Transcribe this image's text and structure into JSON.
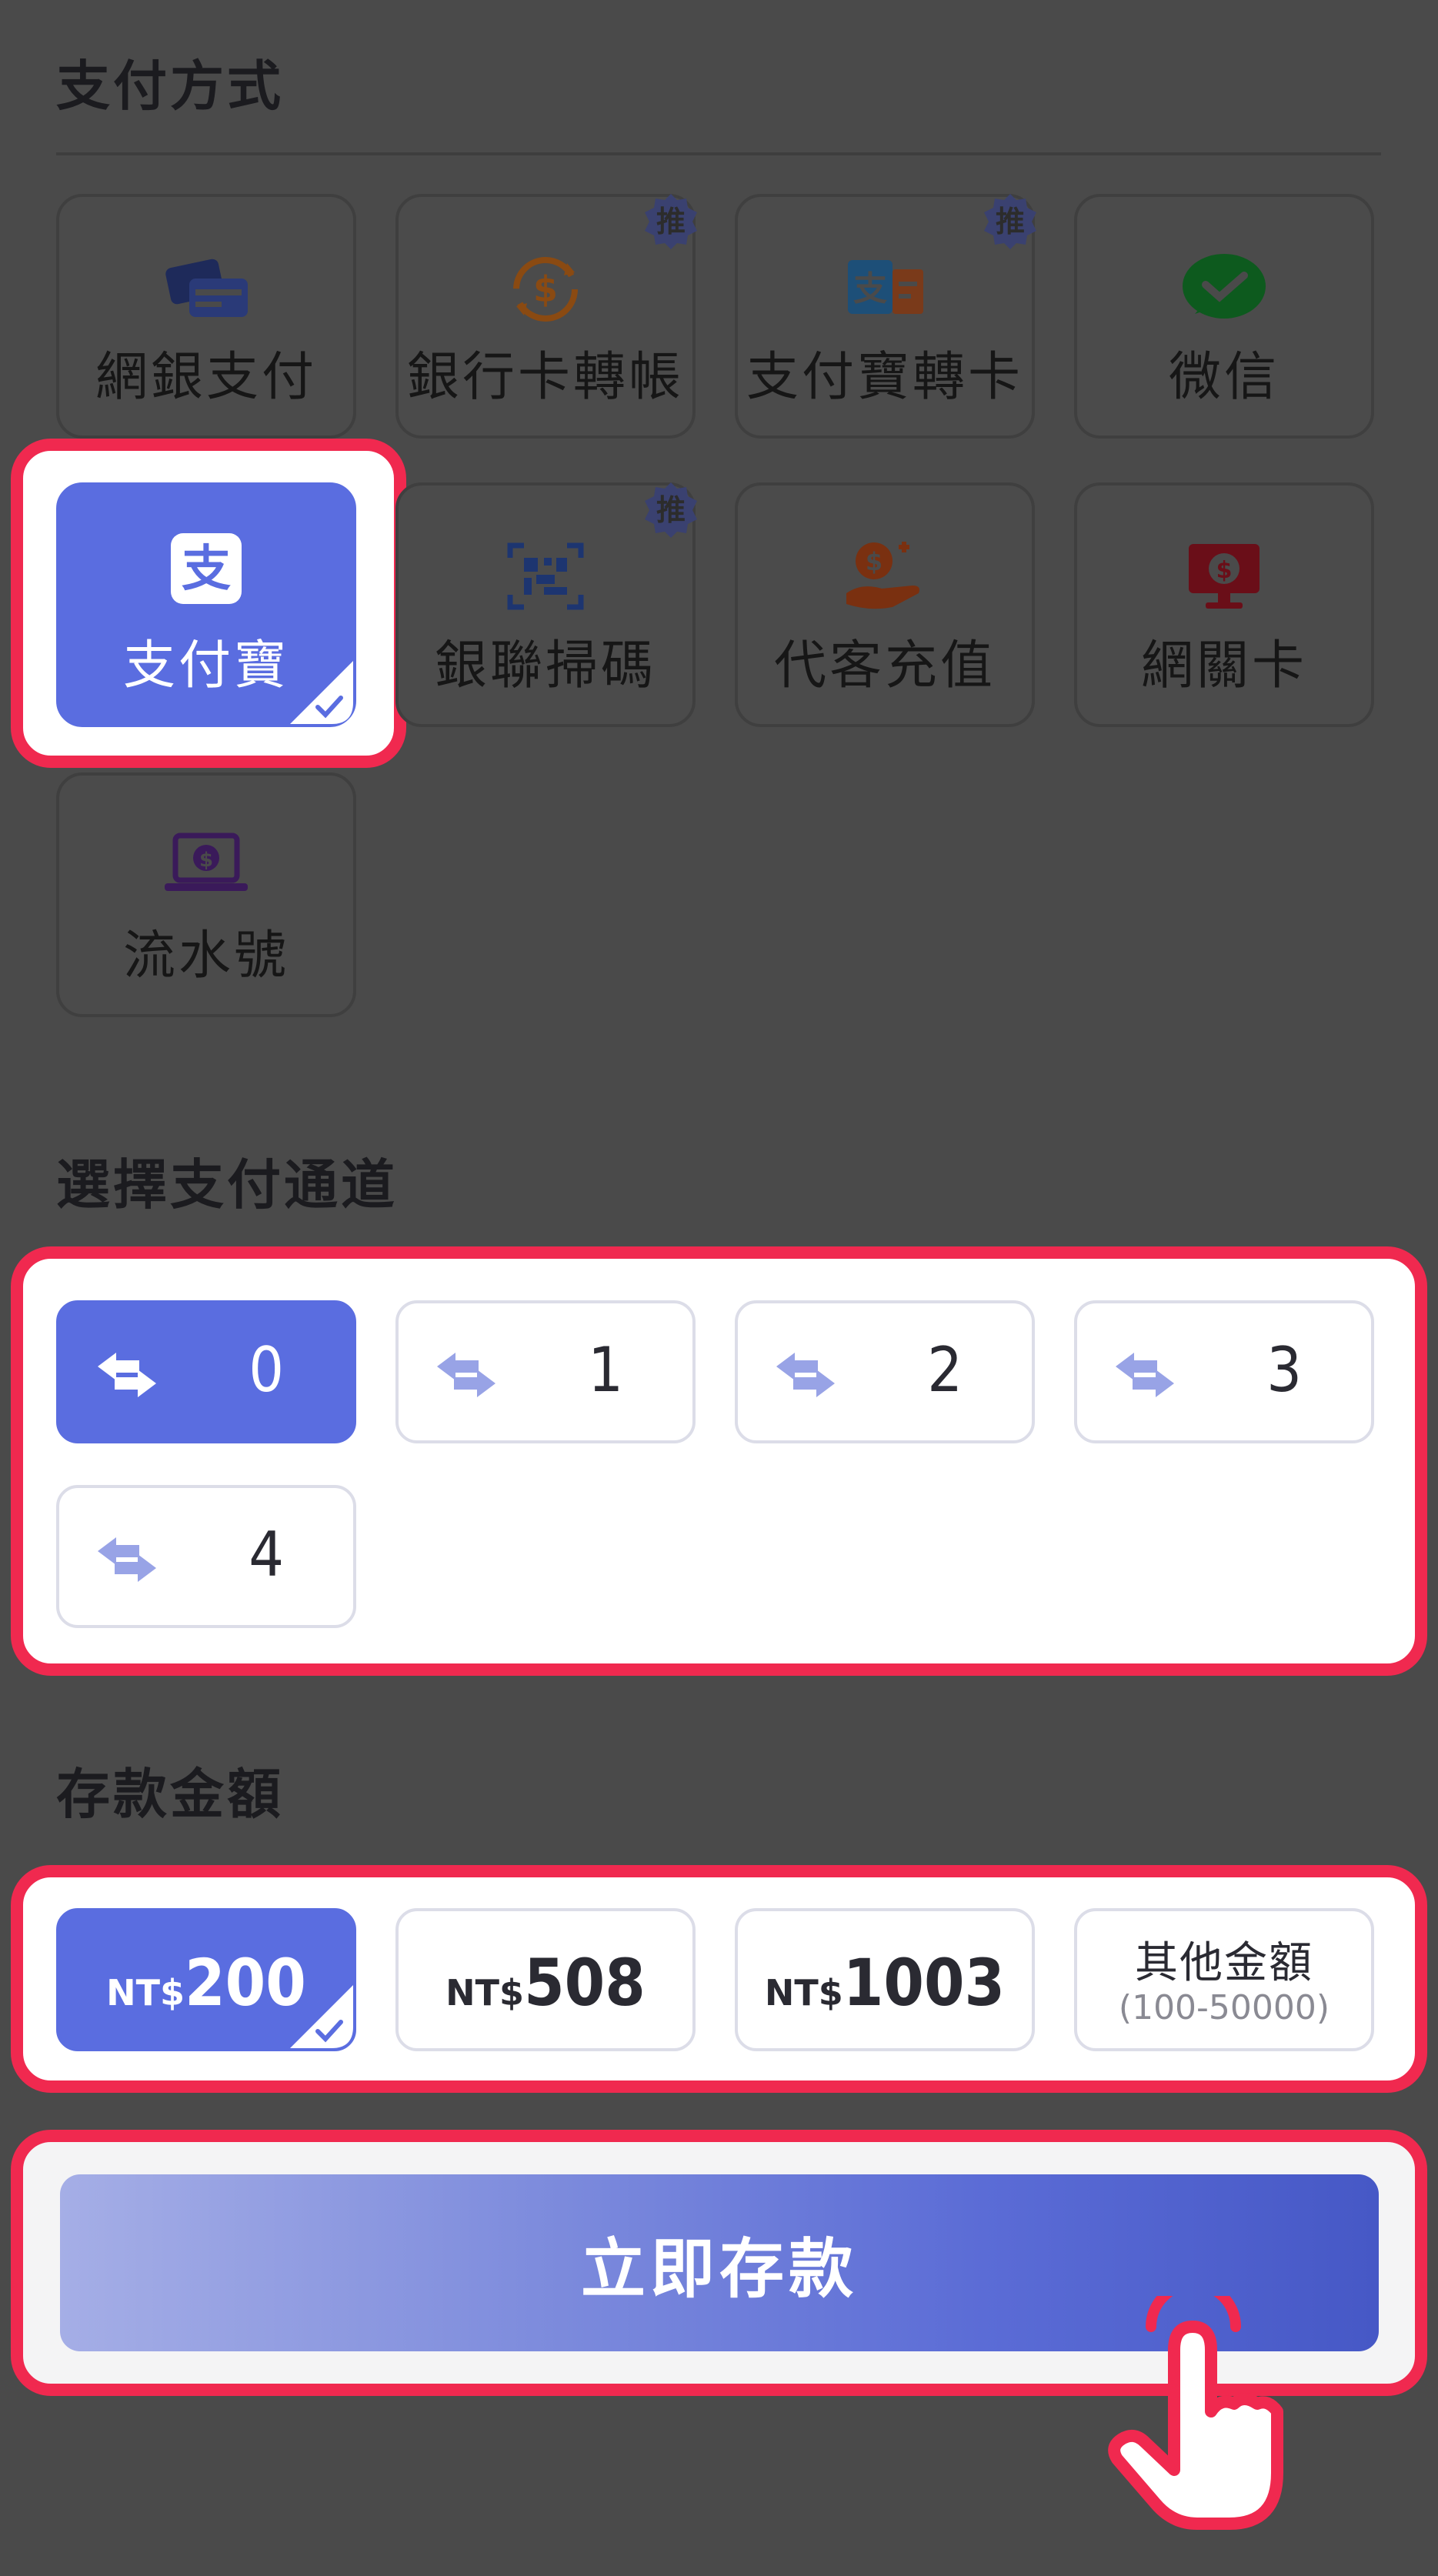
{
  "payment_method": {
    "title": "支付方式",
    "items": [
      {
        "label": "網銀支付",
        "icon": "bank-cards-icon",
        "badge": ""
      },
      {
        "label": "銀行卡轉帳",
        "icon": "dollar-exchange-icon",
        "badge": "推"
      },
      {
        "label": "支付寶轉卡",
        "icon": "alipay-card-icon",
        "badge": "推"
      },
      {
        "label": "微信",
        "icon": "wechat-icon",
        "badge": ""
      },
      {
        "label": "支付寶",
        "icon": "alipay-icon",
        "badge": "",
        "selected": true
      },
      {
        "label": "銀聯掃碼",
        "icon": "qr-scan-icon",
        "badge": "推"
      },
      {
        "label": "代客充值",
        "icon": "hand-coin-icon",
        "badge": ""
      },
      {
        "label": "網關卡",
        "icon": "monitor-dollar-icon",
        "badge": ""
      },
      {
        "label": "流水號",
        "icon": "laptop-dollar-icon",
        "badge": ""
      }
    ]
  },
  "channel": {
    "title": "選擇支付通道",
    "items": [
      {
        "label": "0",
        "selected": true
      },
      {
        "label": "1"
      },
      {
        "label": "2"
      },
      {
        "label": "3"
      },
      {
        "label": "4"
      }
    ]
  },
  "amount": {
    "title": "存款金額",
    "currency": "NT$",
    "options": [
      {
        "value": "200",
        "selected": true
      },
      {
        "value": "508"
      },
      {
        "value": "1003"
      }
    ],
    "other_label": "其他金額",
    "other_range": "(100-50000)"
  },
  "submit": {
    "label": "立即存款"
  },
  "colors": {
    "accent": "#5a6de0",
    "highlight": "#f0294f",
    "overlay": "#4a4a4a"
  }
}
